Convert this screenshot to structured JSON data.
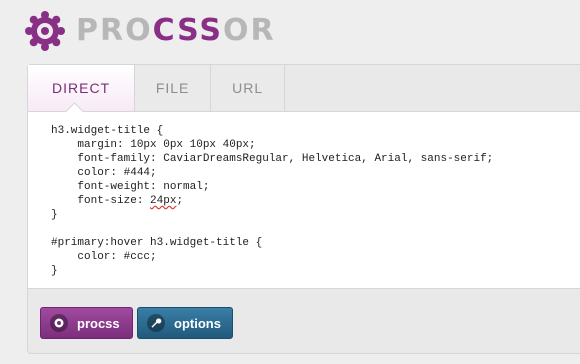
{
  "logo": {
    "text_part1": "PRO",
    "text_part2": "CSS",
    "text_part3": "OR",
    "gear_color": "#8a2f86"
  },
  "tabs": [
    {
      "label": "DIRECT",
      "active": true
    },
    {
      "label": "FILE",
      "active": false
    },
    {
      "label": "URL",
      "active": false
    }
  ],
  "editor": {
    "lines": [
      "h3.widget-title {",
      "    margin: 10px 0px 10px 40px;",
      "    font-family: CaviarDreamsRegular, Helvetica, Arial, sans-serif;",
      "    color: #444;",
      "    font-weight: normal;",
      "    font-size: 24px;",
      "}",
      "",
      "#primary:hover h3.widget-title {",
      "    color: #ccc;",
      "}"
    ]
  },
  "buttons": {
    "procss_label": "procss",
    "options_label": "options"
  },
  "colors": {
    "brand_purple": "#8a2f86",
    "options_blue": "#2b6a90"
  }
}
